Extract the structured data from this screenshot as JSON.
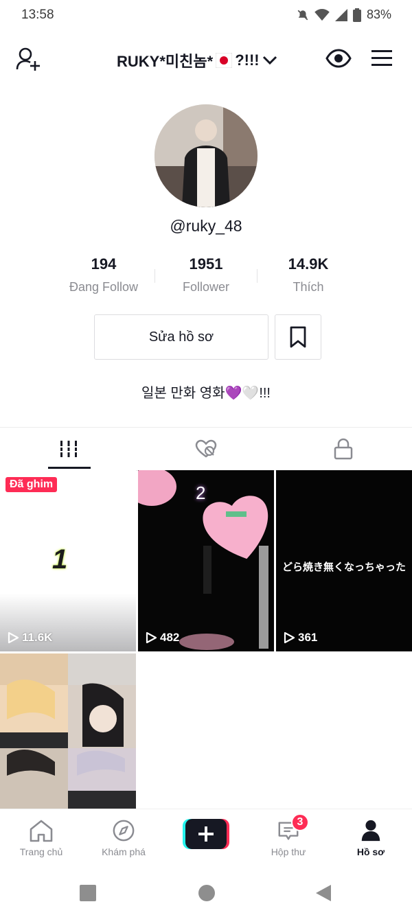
{
  "status": {
    "time": "13:58",
    "battery": "83%"
  },
  "header": {
    "username": "RUKY*미친놈*",
    "username_suffix": "?!!!"
  },
  "profile": {
    "handle": "@ruky_48",
    "stats": [
      {
        "value": "194",
        "label": "Đang Follow"
      },
      {
        "value": "1951",
        "label": "Follower"
      },
      {
        "value": "14.9K",
        "label": "Thích"
      }
    ],
    "edit_button": "Sửa hồ sơ",
    "bio": "일본 만화 영화💜🤍!!!"
  },
  "grid": {
    "pinned_label": "Đã ghim",
    "videos": [
      {
        "views": "11.6K",
        "overlay_text": "1"
      },
      {
        "views": "482",
        "overlay_text": "2"
      },
      {
        "views": "361",
        "overlay_text": "どら焼き無くなっちゃった"
      }
    ]
  },
  "bottom_nav": {
    "items": [
      {
        "label": "Trang chủ",
        "icon": "home-icon"
      },
      {
        "label": "Khám phá",
        "icon": "compass-icon"
      },
      {
        "label": "",
        "icon": "plus-icon"
      },
      {
        "label": "Hộp thư",
        "icon": "inbox-icon",
        "badge": "3"
      },
      {
        "label": "Hồ sơ",
        "icon": "profile-icon"
      }
    ]
  },
  "colors": {
    "accent": "#fe2c55",
    "text": "#161823",
    "muted": "#8a8b91"
  }
}
